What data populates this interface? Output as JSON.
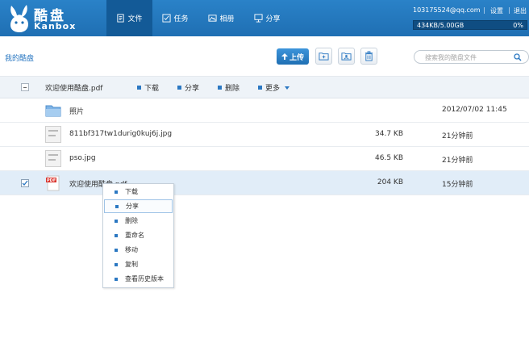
{
  "header": {
    "logo_cn": "酷盘",
    "logo_en": "Kanbox",
    "nav": [
      {
        "label": "文件",
        "icon": "file-icon"
      },
      {
        "label": "任务",
        "icon": "task-icon"
      },
      {
        "label": "相册",
        "icon": "photo-icon"
      },
      {
        "label": "分享",
        "icon": "share-icon"
      }
    ],
    "user_email": "103175524@qq.com",
    "settings_label": "设置",
    "logout_label": "退出",
    "quota_text": "434KB/5.00GB",
    "quota_percent": "0%",
    "quota_fraction": 0.0
  },
  "toolbar": {
    "breadcrumb": "我的酷盘",
    "upload_label": "上传",
    "search_placeholder": "搜索我的酷盘文件"
  },
  "action_bar": {
    "selected_name": "欢迎使用酷盘.pdf",
    "actions": [
      "下载",
      "分享",
      "删除",
      "更多"
    ]
  },
  "files": [
    {
      "name": "照片",
      "size": "",
      "time": "2012/07/02 11:45",
      "type": "folder"
    },
    {
      "name": "811bf317tw1durig0kuj6j.jpg",
      "size": "34.7 KB",
      "time": "21分钟前",
      "type": "image"
    },
    {
      "name": "pso.jpg",
      "size": "46.5 KB",
      "time": "21分钟前",
      "type": "image"
    },
    {
      "name": "欢迎使用酷盘.pdf",
      "size": "204 KB",
      "time": "15分钟前",
      "type": "pdf"
    }
  ],
  "context_menu": {
    "items": [
      "下载",
      "分享",
      "删除",
      "重命名",
      "移动",
      "复制",
      "查看历史版本"
    ]
  },
  "colors": {
    "header": "#2a82c8",
    "accent": "#2b78c2",
    "selected_row": "#e1edf8"
  }
}
